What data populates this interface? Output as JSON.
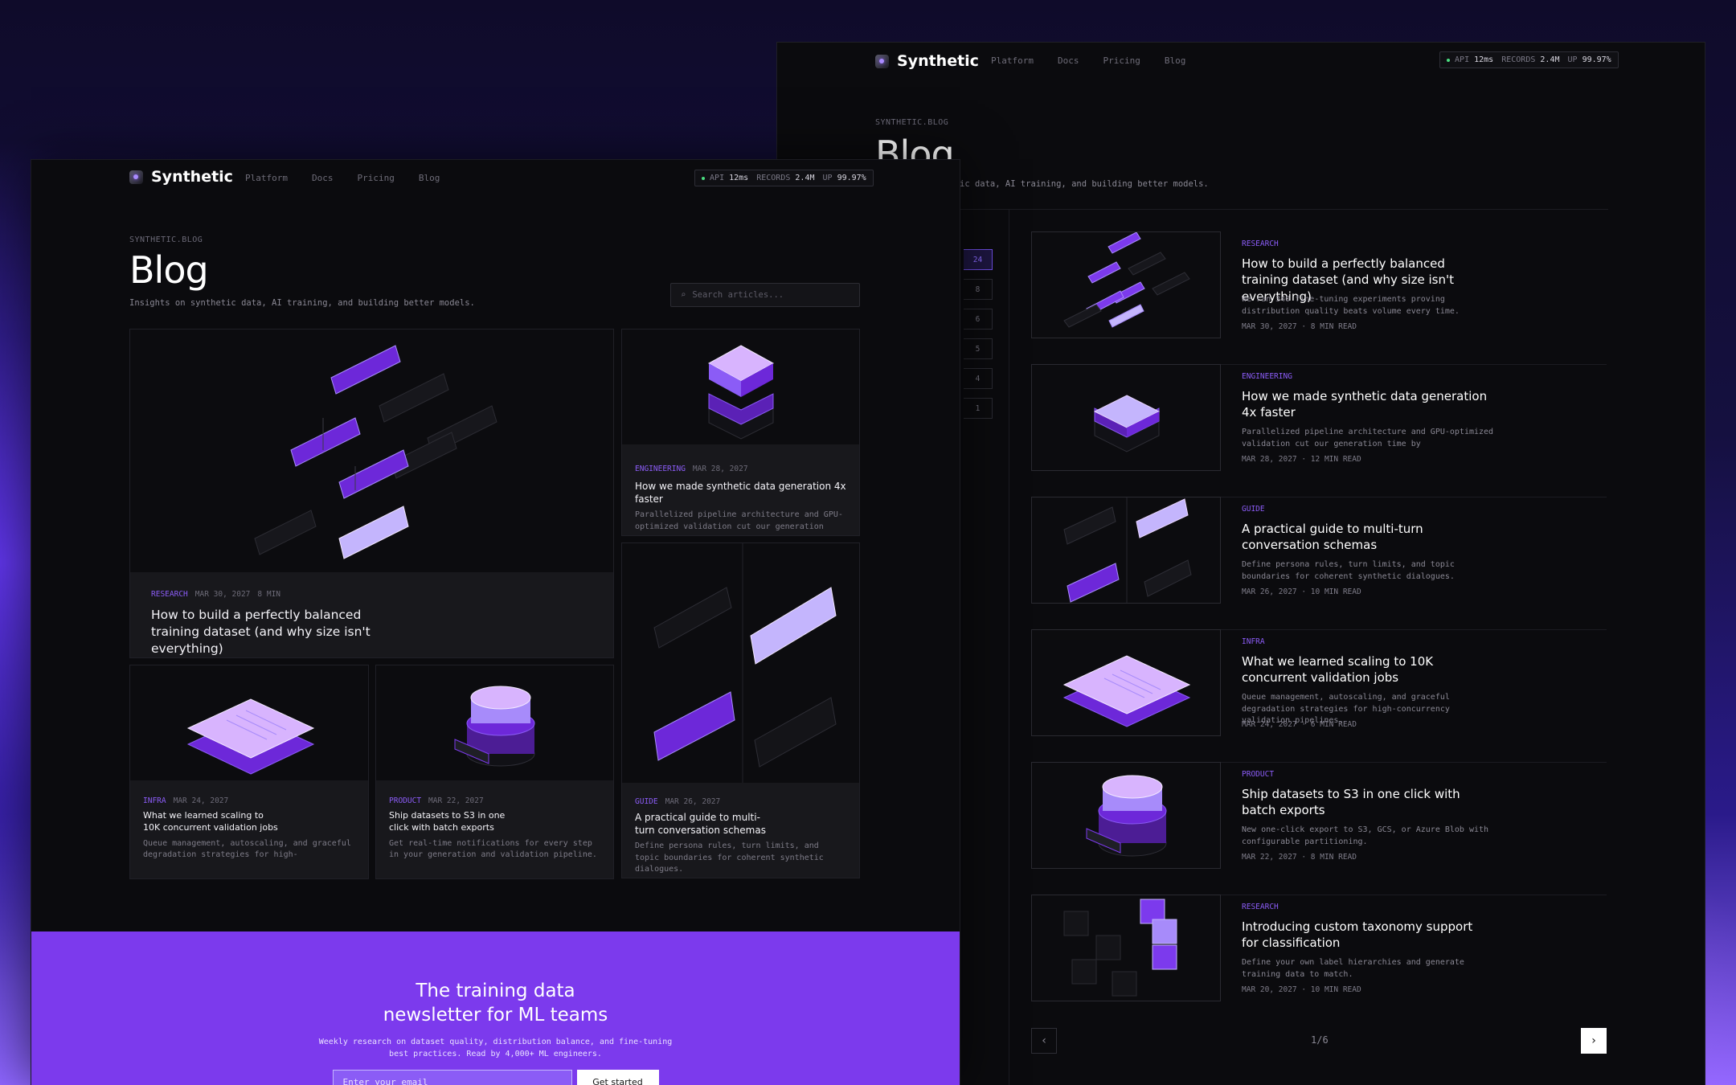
{
  "brand": {
    "name": "Synthetic"
  },
  "nav": [
    "Platform",
    "Docs",
    "Pricing",
    "Blog"
  ],
  "status": {
    "api_label": "API",
    "api_value": "12ms",
    "records_label": "RECORDS",
    "records_value": "2.4M",
    "up_label": "UP",
    "up_value": "99.97%"
  },
  "page": {
    "eyebrow": "SYNTHETIC.BLOG",
    "title": "Blog",
    "subtitle": "Insights on synthetic data, AI training, and building better models.",
    "back_subtitle_fragment": "ic data, AI training, and building better models."
  },
  "search": {
    "placeholder": "Search articles..."
  },
  "front_posts": [
    {
      "tag": "RESEARCH",
      "date": "MAR 30, 2027",
      "read": "8 MIN",
      "title": "How to build a perfectly balanced training dataset (and why size isn't everything)",
      "desc": ""
    },
    {
      "tag": "ENGINEERING",
      "date": "MAR 28, 2027",
      "read": "",
      "title": "How we made synthetic data generation 4x faster",
      "desc": "Parallelized pipeline architecture and GPU-optimized validation cut our generation time by…"
    },
    {
      "tag": "INFRA",
      "date": "MAR 24, 2027",
      "read": "",
      "title": "What we learned scaling to 10K concurrent validation jobs",
      "desc": "Queue management, autoscaling, and graceful degradation strategies for high-concurrency…"
    },
    {
      "tag": "PRODUCT",
      "date": "MAR 22, 2027",
      "read": "",
      "title": "Ship datasets to S3 in one click with batch exports",
      "desc": "Get real-time notifications for every step in your generation and validation pipeline."
    },
    {
      "tag": "GUIDE",
      "date": "MAR 26, 2027",
      "read": "",
      "title": "A practical guide to multi-turn conversation schemas",
      "desc": "Define persona rules, turn limits, and topic boundaries for coherent synthetic dialogues."
    }
  ],
  "back_posts": [
    {
      "tag": "RESEARCH",
      "title": "How to build a perfectly balanced training dataset (and why size isn't everything)",
      "desc": "We ran 340 fine-tuning experiments proving distribution quality beats volume every time.",
      "meta": "MAR 30, 2027 · 8 MIN READ"
    },
    {
      "tag": "ENGINEERING",
      "title": "How we made synthetic data generation 4x faster",
      "desc": "Parallelized pipeline architecture and GPU-optimized validation cut our generation time by",
      "meta": "MAR 28, 2027 · 12 MIN READ"
    },
    {
      "tag": "GUIDE",
      "title": "A practical guide to multi-turn conversation schemas",
      "desc": "Define persona rules, turn limits, and topic boundaries for coherent synthetic dialogues.",
      "meta": "MAR 26, 2027 · 10 MIN READ"
    },
    {
      "tag": "INFRA",
      "title": "What we learned scaling to 10K concurrent validation jobs",
      "desc": "Queue management, autoscaling, and graceful degradation strategies for high-concurrency validation pipelines.",
      "meta": "MAR 24, 2027 · 6 MIN READ"
    },
    {
      "tag": "PRODUCT",
      "title": "Ship datasets to S3 in one click with batch exports",
      "desc": "New one-click export to S3, GCS, or Azure Blob with configurable partitioning.",
      "meta": "MAR 22, 2027 · 8 MIN READ"
    },
    {
      "tag": "RESEARCH",
      "title": "Introducing custom taxonomy support for classification",
      "desc": "Define your own label hierarchies and generate training data to match.",
      "meta": "MAR 20, 2027 · 10 MIN READ"
    }
  ],
  "category_counts": [
    "24",
    "8",
    "6",
    "5",
    "4",
    "1"
  ],
  "pagination": {
    "label": "1/6"
  },
  "newsletter": {
    "title_line1": "The training data",
    "title_line2": "newsletter for ML teams",
    "desc_line1": "Weekly research on dataset quality, distribution balance, and fine-tuning",
    "desc_line2": "best practices. Read by 4,000+ ML engineers.",
    "email_placeholder": "Enter your email",
    "cta": "Get started"
  },
  "colors": {
    "accent": "#8b5cf6",
    "cta_bg": "#7c3aed",
    "page_bg": "#0b0b0e"
  }
}
